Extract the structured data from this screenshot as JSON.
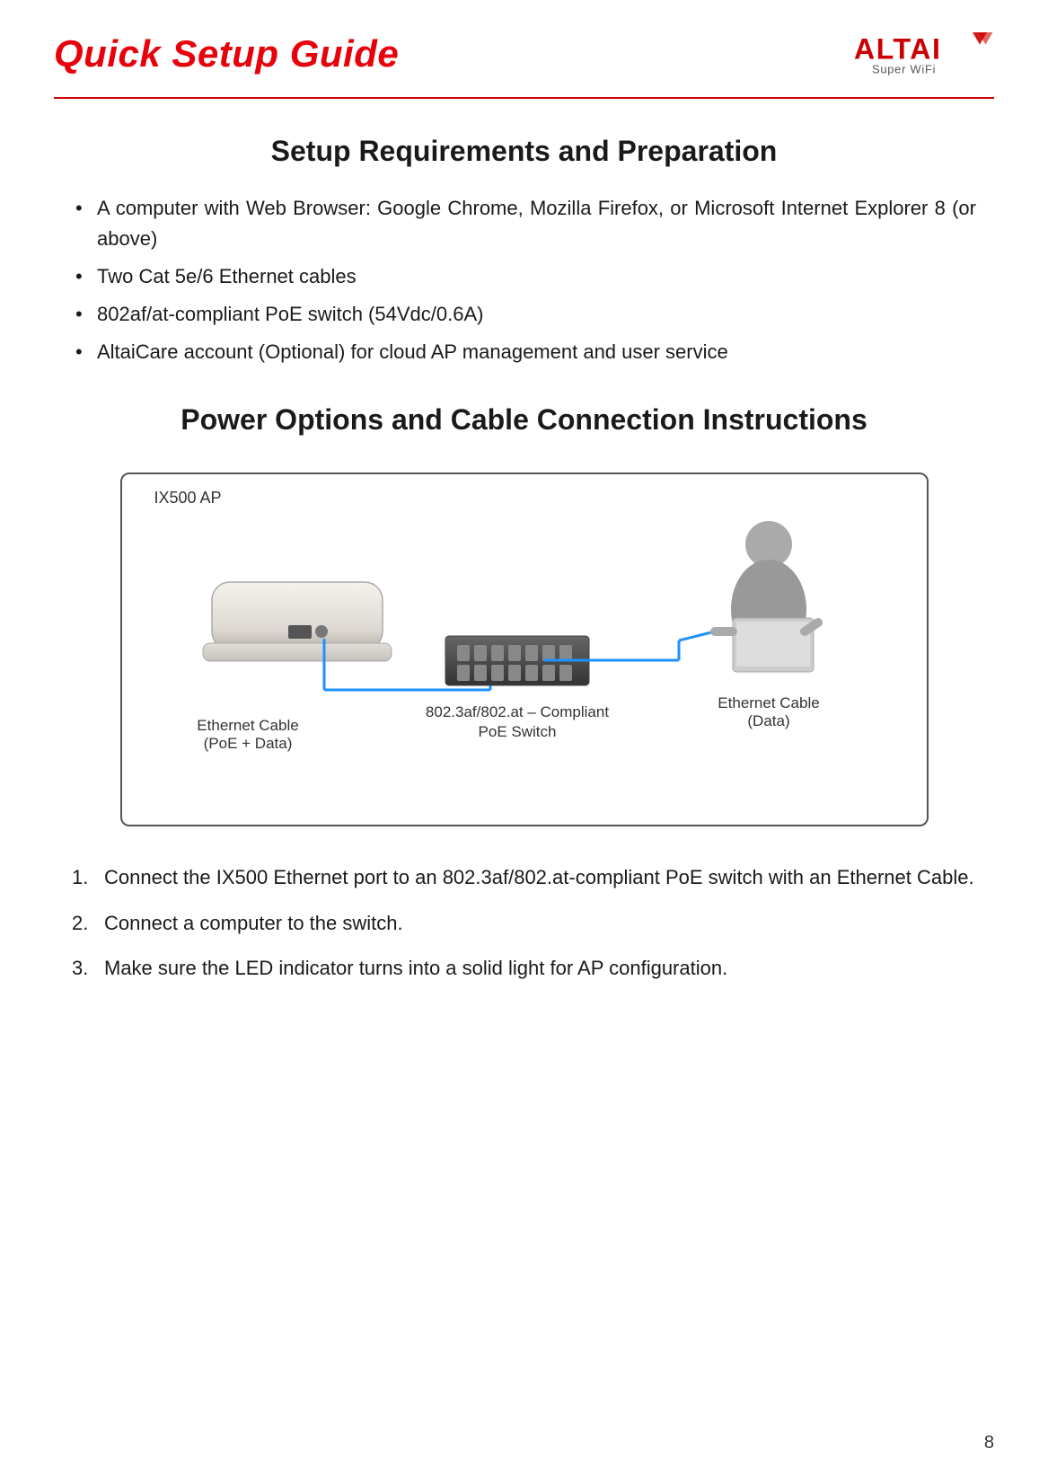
{
  "header": {
    "title": "Quick Setup Guide",
    "logo_alt_text": "ALTAI Super WiFi"
  },
  "setup_section": {
    "title": "Setup Requirements and Preparation",
    "bullets": [
      "A computer with Web Browser: Google Chrome, Mozilla Firefox, or Microsoft Internet Explorer 8 (or above)",
      "Two Cat 5e/6 Ethernet cables",
      "802af/at-compliant PoE switch (54Vdc/0.6A)",
      "AltaiCare account (Optional) for cloud AP management and user service"
    ]
  },
  "power_section": {
    "title": "Power Options and Cable Connection Instructions",
    "diagram": {
      "ap_label": "IX500 AP",
      "cable_left_label": "Ethernet Cable\n(PoE + Data)",
      "switch_label": "802.3af/802.at – Compliant\nPoE Switch",
      "cable_right_label": "Ethernet Cable\n(Data)"
    },
    "steps": [
      "Connect the IX500 Ethernet port to an 802.3af/802.at-compliant PoE switch with an Ethernet Cable.",
      "Connect a computer to the switch.",
      "Make sure the LED indicator turns into a solid light for AP configuration."
    ]
  },
  "page_number": "8"
}
